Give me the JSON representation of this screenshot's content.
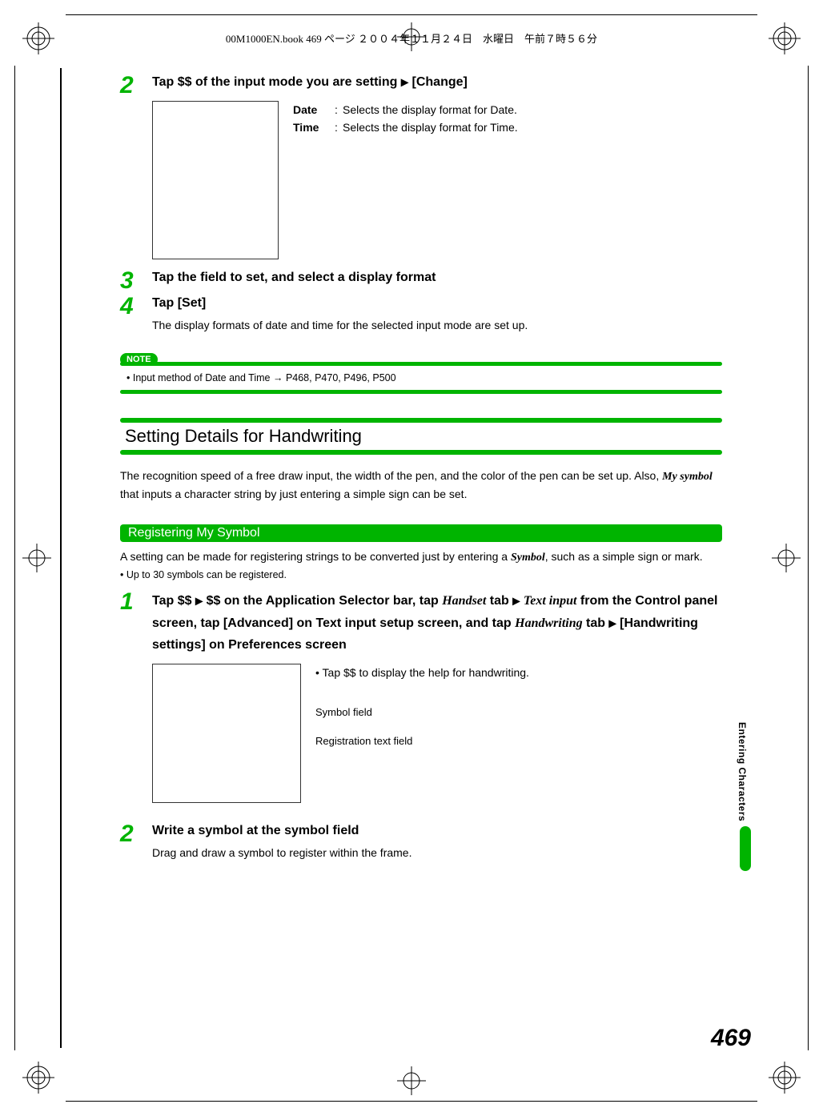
{
  "header": "00M1000EN.book  469 ページ  ２００４年１１月２４日　水曜日　午前７時５６分",
  "steps_top": [
    {
      "num": "2",
      "title_parts": [
        "Tap $$ of the input mode you are setting ",
        " [Change]"
      ],
      "kv": [
        {
          "k": "Date",
          "v": "Selects the display format for Date."
        },
        {
          "k": "Time",
          "v": "Selects the display format for Time."
        }
      ]
    },
    {
      "num": "3",
      "title": "Tap the field to set, and select a display format"
    },
    {
      "num": "4",
      "title": "Tap [Set]",
      "text": "The display formats of date and time for the selected input mode are set up."
    }
  ],
  "note": {
    "label": "NOTE",
    "text": "Input method of Date and Time ",
    "arrow": "→",
    "refs": " P468, P470, P496, P500"
  },
  "section": {
    "title": "Setting Details for Handwriting",
    "text_before": "The recognition speed of a free draw input, the width of the pen, and the color of the pen can be set up. Also, ",
    "my_symbol": "My symbol",
    "text_after": " that inputs a character string by just entering a simple sign can be set."
  },
  "subsection": {
    "head": "Registering My Symbol",
    "text_before": "A setting can be made for registering strings to be converted just by entering a ",
    "symbol": "Symbol",
    "text_after": ", such as a simple sign or mark.",
    "bullet": "Up to 30 symbols can be registered."
  },
  "steps_bottom": [
    {
      "num": "1",
      "title_p1": "Tap $$ ",
      "title_p2": " $$ on the Application Selector bar, tap ",
      "handset": "Handset",
      "title_p3": " tab ",
      "textinput": "Text input",
      "title_p4": " from the Control panel screen, tap [Advanced] on Text input setup screen, and tap ",
      "handwriting": "Handwriting",
      "title_p5": " tab ",
      "title_p6": " [Handwriting settings] on Preferences screen",
      "help_bullet": "Tap $$ to display the help for handwriting.",
      "labels": [
        "Symbol field",
        "Registration text field"
      ]
    },
    {
      "num": "2",
      "title": "Write a symbol at the symbol field",
      "text": "Drag and draw a symbol to register within the frame."
    }
  ],
  "side_tab": "Entering Characters",
  "page_num": "469"
}
